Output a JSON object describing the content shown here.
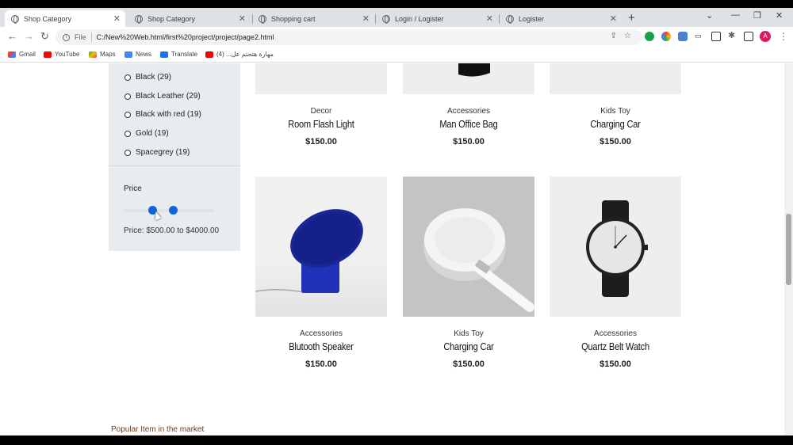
{
  "browser": {
    "tabs": [
      {
        "title": "Shop Category",
        "active": true
      },
      {
        "title": "Shop Category",
        "active": false
      },
      {
        "title": "Shopping cart",
        "active": false
      },
      {
        "title": "Login / Logister",
        "active": false
      },
      {
        "title": "Logister",
        "active": false
      }
    ],
    "new_tab": "+",
    "url_scheme": "File",
    "url": "C:/New%20Web.html/first%20project/project/page2.html",
    "bookmarks": [
      "Gmail",
      "YouTube",
      "Maps",
      "News",
      "Translate",
      "مهارة هتحتم عل... (4)"
    ],
    "profile_initial": "A"
  },
  "sidebar": {
    "colors": [
      {
        "label": "Black (29)"
      },
      {
        "label": "Black Leather (29)"
      },
      {
        "label": "Black with red (19)"
      },
      {
        "label": "Gold (19)"
      },
      {
        "label": "Spacegrey (19)"
      }
    ],
    "price_title": "Price",
    "price_range_text": "Price: $500.00 to $4000.00"
  },
  "products": [
    {
      "category": "Decor",
      "name": "Room Flash Light",
      "price": "$150.00"
    },
    {
      "category": "Accessories",
      "name": "Man Office Bag",
      "price": "$150.00"
    },
    {
      "category": "Kids Toy",
      "name": "Charging Car",
      "price": "$150.00"
    },
    {
      "category": "Accessories",
      "name": "Blutooth Speaker",
      "price": "$150.00"
    },
    {
      "category": "Kids Toy",
      "name": "Charging Car",
      "price": "$150.00"
    },
    {
      "category": "Accessories",
      "name": "Quartz Belt Watch",
      "price": "$150.00"
    }
  ],
  "section": {
    "popular_label": "Popular Item in the market"
  },
  "colors": {
    "accent_blue": "#1463d8",
    "sidebar_bg": "#e8ecee",
    "popular_text": "#6b3a22"
  }
}
